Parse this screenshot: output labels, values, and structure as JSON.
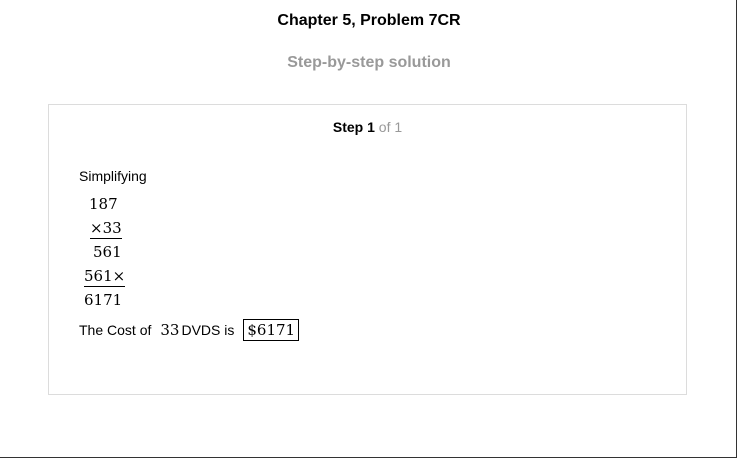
{
  "header": {
    "title": "Chapter 5, Problem 7CR",
    "subtitle": "Step-by-step solution"
  },
  "step": {
    "label": "Step",
    "number": "1",
    "of_total": "of 1"
  },
  "solution": {
    "intro": "Simplifying",
    "lines": [
      "187",
      "×33",
      "561",
      "561×",
      "6171"
    ],
    "cost_prefix": "The Cost of",
    "quantity": "33",
    "cost_middle": "DVDS is",
    "answer": "$6171"
  }
}
